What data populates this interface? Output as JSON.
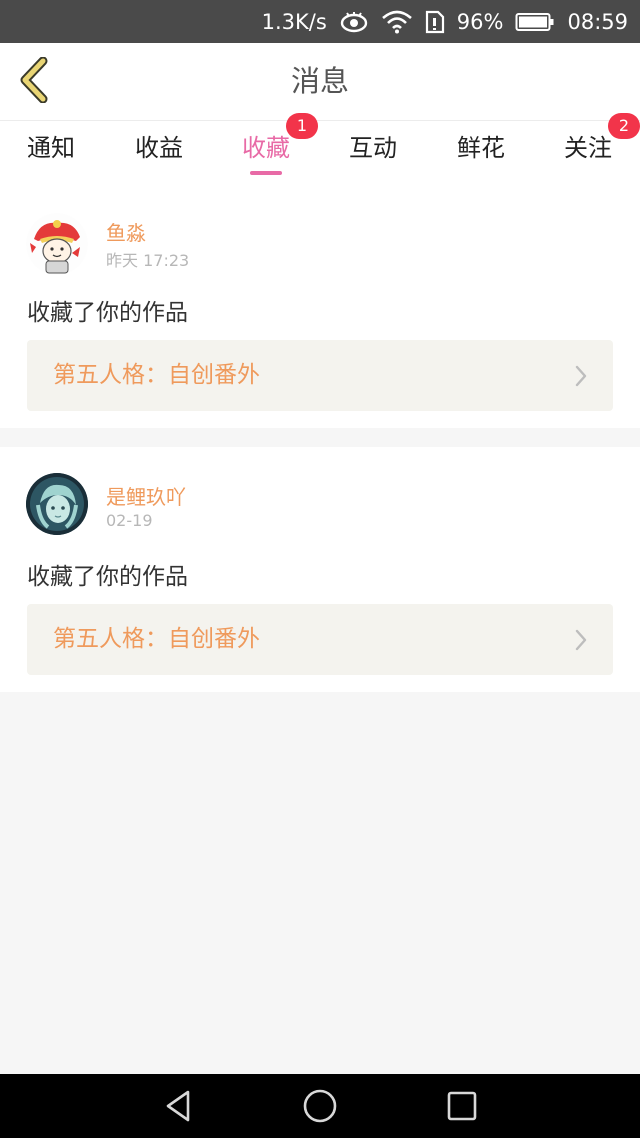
{
  "status_bar": {
    "net_speed": "1.3K/s",
    "battery_percent": "96%",
    "time": "08:59"
  },
  "header": {
    "title": "消息"
  },
  "tabs": [
    {
      "label": "通知",
      "active": false,
      "badge": ""
    },
    {
      "label": "收益",
      "active": false,
      "badge": ""
    },
    {
      "label": "收藏",
      "active": true,
      "badge": "1"
    },
    {
      "label": "互动",
      "active": false,
      "badge": ""
    },
    {
      "label": "鲜花",
      "active": false,
      "badge": ""
    },
    {
      "label": "关注",
      "active": false,
      "badge": "2"
    }
  ],
  "messages": [
    {
      "username": "鱼淼",
      "time": "昨天 17:23",
      "action": "收藏了你的作品",
      "work_title": "第五人格：自创番外"
    },
    {
      "username": "是鲤玖吖",
      "time": "02-19",
      "action": "收藏了你的作品",
      "work_title": "第五人格：自创番外"
    }
  ],
  "colors": {
    "accent_pink": "#e86aa6",
    "username_orange": "#ef9a5c",
    "badge_red": "#f2344a",
    "back_arrow_gold": "#e9d574"
  },
  "icons": {
    "back": "chevron-left-icon",
    "eye": "eye-icon",
    "wifi": "wifi-icon",
    "sim": "sim-card-icon",
    "battery": "battery-icon",
    "chevron": "chevron-right-icon",
    "nav_back": "triangle-back-icon",
    "nav_home": "circle-home-icon",
    "nav_recent": "square-recent-icon"
  }
}
